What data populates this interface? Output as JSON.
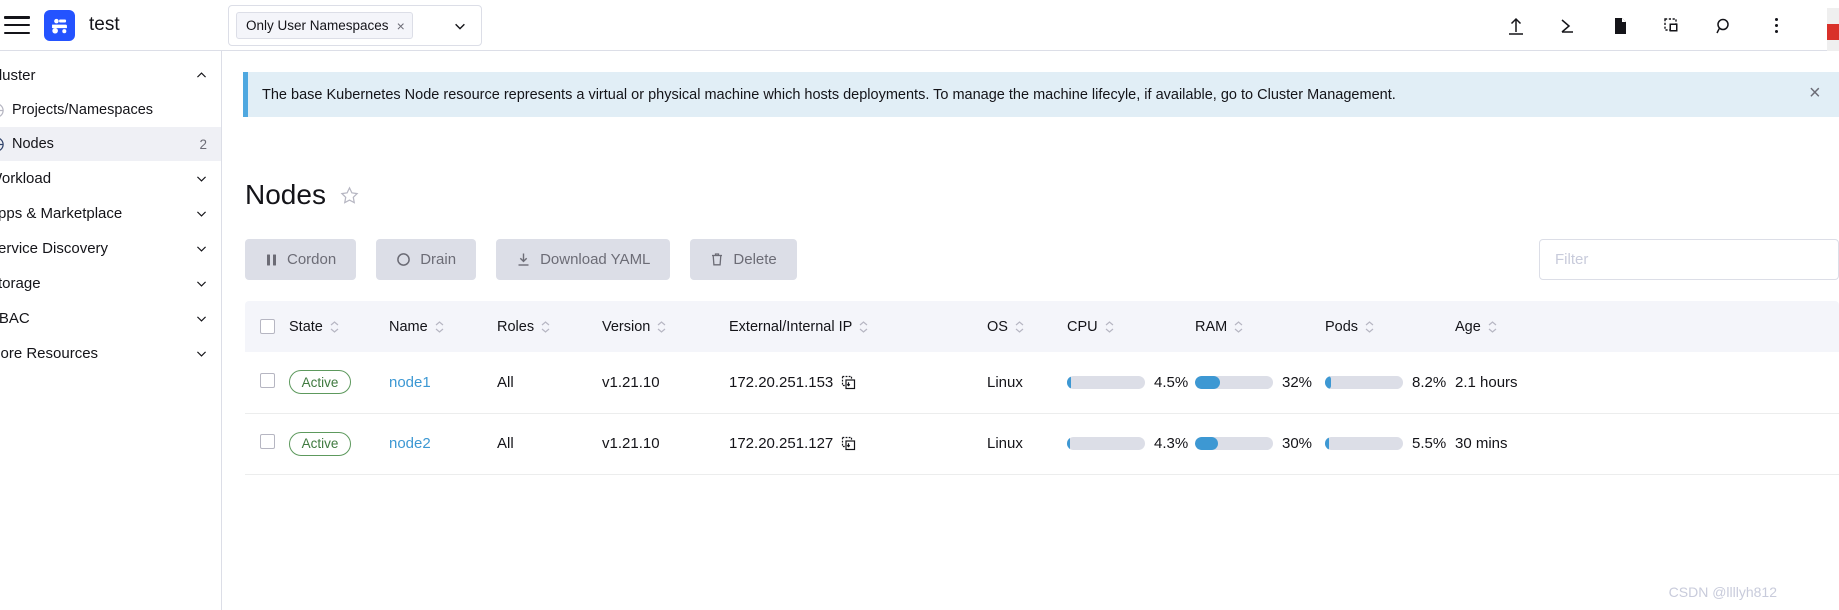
{
  "header": {
    "menu_icon": "hamburger-icon",
    "brand_name": "test",
    "namespace_filter": {
      "pill_label": "Only User Namespaces",
      "remove_label": "×",
      "chevron_icon": "chevron-down-icon"
    },
    "icons": [
      {
        "name": "import-yaml-icon",
        "title": "Import YAML"
      },
      {
        "name": "kubectl-shell-icon",
        "title": "Kubectl Shell"
      },
      {
        "name": "docs-icon",
        "title": "Docs"
      },
      {
        "name": "cluster-dashboard-icon",
        "title": "Cluster Dashboard"
      },
      {
        "name": "search-icon",
        "title": "Search"
      },
      {
        "name": "kebab-menu-icon",
        "title": "More"
      }
    ]
  },
  "sidebar": {
    "group_label": "Cluster",
    "items": [
      {
        "label": "Projects/Namespaces",
        "icon": "globe-icon",
        "count": "",
        "active": false,
        "type": "link"
      },
      {
        "label": "Nodes",
        "icon": "globe-icon",
        "count": "2",
        "active": true,
        "type": "link"
      },
      {
        "label": "Workload",
        "icon": "chevron-down-icon",
        "count": "",
        "active": false,
        "type": "group"
      },
      {
        "label": "Apps & Marketplace",
        "icon": "chevron-down-icon",
        "count": "",
        "active": false,
        "type": "group"
      },
      {
        "label": "Service Discovery",
        "icon": "chevron-down-icon",
        "count": "",
        "active": false,
        "type": "group"
      },
      {
        "label": "Storage",
        "icon": "chevron-down-icon",
        "count": "",
        "active": false,
        "type": "group"
      },
      {
        "label": "RBAC",
        "icon": "chevron-down-icon",
        "count": "",
        "active": false,
        "type": "group"
      },
      {
        "label": "More Resources",
        "icon": "chevron-down-icon",
        "count": "",
        "active": false,
        "type": "group"
      }
    ]
  },
  "banner": {
    "text": "The base Kubernetes Node resource represents a virtual or physical machine which hosts deployments. To manage the machine lifecyle, if available, go to Cluster Management.",
    "close_label": "×",
    "accent_color": "#4fa8e0",
    "background_color": "#e1eef6"
  },
  "page": {
    "title": "Nodes",
    "favorite_icon": "star-icon"
  },
  "toolbar": {
    "buttons": [
      {
        "label": "Cordon",
        "icon": "pause-icon"
      },
      {
        "label": "Drain",
        "icon": "circle-icon"
      },
      {
        "label": "Download YAML",
        "icon": "download-icon"
      },
      {
        "label": "Delete",
        "icon": "trash-icon"
      }
    ],
    "filter": {
      "placeholder": "Filter",
      "value": ""
    }
  },
  "table": {
    "columns": [
      {
        "label": "",
        "sortable": false,
        "key": "select"
      },
      {
        "label": "State",
        "sortable": true,
        "key": "state"
      },
      {
        "label": "Name",
        "sortable": true,
        "key": "name"
      },
      {
        "label": "Roles",
        "sortable": true,
        "key": "roles"
      },
      {
        "label": "Version",
        "sortable": true,
        "key": "version"
      },
      {
        "label": "External/Internal IP",
        "sortable": true,
        "key": "ip"
      },
      {
        "label": "OS",
        "sortable": true,
        "key": "os"
      },
      {
        "label": "CPU",
        "sortable": true,
        "key": "cpu"
      },
      {
        "label": "RAM",
        "sortable": true,
        "key": "ram"
      },
      {
        "label": "Pods",
        "sortable": true,
        "key": "pods"
      },
      {
        "label": "Age",
        "sortable": true,
        "key": "age"
      }
    ],
    "rows": [
      {
        "selected": false,
        "state": "Active",
        "name": "node1",
        "roles": "All",
        "version": "v1.21.10",
        "ip": "172.20.251.153",
        "copy_icon": "copy-icon",
        "os": "Linux",
        "cpu": {
          "label": "4.5%",
          "percent": 4.5
        },
        "ram": {
          "label": "32%",
          "percent": 32
        },
        "pods": {
          "label": "8.2%",
          "percent": 8.2
        },
        "age": "2.1 hours"
      },
      {
        "selected": false,
        "state": "Active",
        "name": "node2",
        "roles": "All",
        "version": "v1.21.10",
        "ip": "172.20.251.127",
        "copy_icon": "copy-icon",
        "os": "Linux",
        "cpu": {
          "label": "4.3%",
          "percent": 4.3
        },
        "ram": {
          "label": "30%",
          "percent": 30
        },
        "pods": {
          "label": "5.5%",
          "percent": 5.5
        },
        "age": "30 mins"
      }
    ]
  },
  "watermark": "CSDN @llllyh812",
  "colors": {
    "brand_blue": "#2453ff",
    "link_blue": "#3d98d3",
    "meter_fill": "#3d98d3",
    "meter_track": "#dcdee7",
    "active_green": "#3f7a3f",
    "button_bg": "#dcdee7"
  }
}
